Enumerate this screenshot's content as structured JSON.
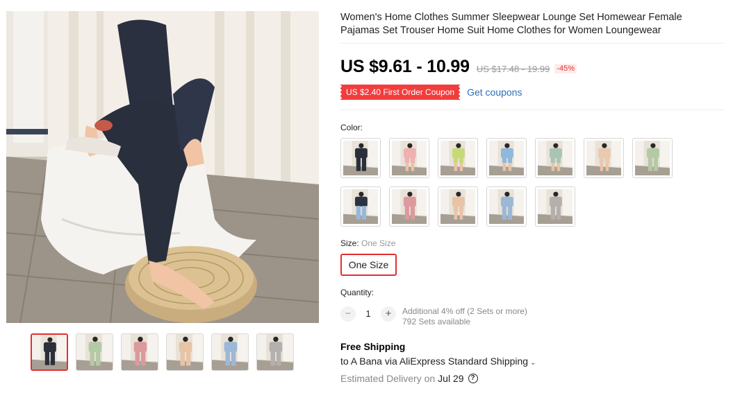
{
  "product": {
    "title": "Women's Home Clothes Summer Sleepwear Lounge Set Homewear Female Pajamas Set Trouser Home Suit Home Clothes for Women Loungewear"
  },
  "price": {
    "current": "US $9.61 - 10.99",
    "original": "US $17.48 - 19.99",
    "discount": "-45%"
  },
  "coupon": {
    "badge": "US $2.40 First Order Coupon",
    "link": "Get coupons"
  },
  "color": {
    "label": "Color:",
    "options": [
      {
        "name": "black",
        "top": "#2a2f3a",
        "bottom": "#2a2f3a"
      },
      {
        "name": "pink shorts",
        "top": "#efb1b0",
        "bottom": "#efb1b0"
      },
      {
        "name": "green shorts",
        "top": "#c7d977",
        "bottom": "#c7d977"
      },
      {
        "name": "blue shorts",
        "top": "#8fb8dc",
        "bottom": "#8fb8dc"
      },
      {
        "name": "sage shorts",
        "top": "#a9c4b2",
        "bottom": "#a9c4b2"
      },
      {
        "name": "apricot shorts",
        "top": "#e9c9b0",
        "bottom": "#e9c9b0"
      },
      {
        "name": "green trousers",
        "top": "#b5c9a5",
        "bottom": "#b5c9a5"
      },
      {
        "name": "blue black",
        "top": "#2d3240",
        "bottom": "#9bb7d8"
      },
      {
        "name": "pink trousers",
        "top": "#dc9a9c",
        "bottom": "#dc9a9c"
      },
      {
        "name": "apricot seated",
        "top": "#e7c4a6",
        "bottom": "#e7c4a6"
      },
      {
        "name": "blue trousers",
        "top": "#9db8d6",
        "bottom": "#9db8d6"
      },
      {
        "name": "grey trousers",
        "top": "#b4b0ae",
        "bottom": "#b4b0ae"
      }
    ]
  },
  "size": {
    "label": "Size:",
    "selected": "One Size",
    "option": "One Size"
  },
  "quantity": {
    "label": "Quantity:",
    "value": "1",
    "minus": "−",
    "plus": "+",
    "additional": "Additional 4% off (2 Sets or more)",
    "available": "792 Sets available"
  },
  "shipping": {
    "title": "Free Shipping",
    "line": "to A Bana via AliExpress Standard Shipping",
    "eta_label": "Estimated Delivery on",
    "eta_date": "Jul 29"
  },
  "icons": {
    "chevron": "chevron-down-icon",
    "help": "question-circle-icon"
  },
  "thumbnails": [
    {
      "top": "#2a2f3a",
      "bottom": "#2a2f3a"
    },
    {
      "top": "#b5c9a5",
      "bottom": "#b5c9a5"
    },
    {
      "top": "#dc9a9c",
      "bottom": "#dc9a9c"
    },
    {
      "top": "#e7c4a6",
      "bottom": "#e7c4a6"
    },
    {
      "top": "#9db8d6",
      "bottom": "#9db8d6"
    },
    {
      "top": "#b4b0ae",
      "bottom": "#b4b0ae"
    }
  ],
  "colors": {
    "accent": "#e62e2e",
    "coupon_bg": "#f23d3d",
    "link": "#2e6fb5"
  }
}
